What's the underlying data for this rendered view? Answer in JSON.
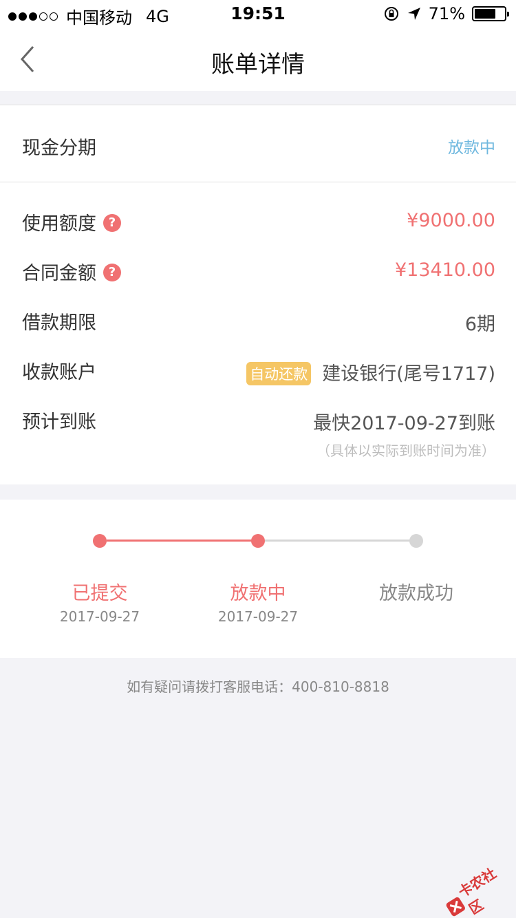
{
  "status_bar": {
    "signal_dots": [
      true,
      true,
      true,
      false,
      false
    ],
    "carrier": "中国移动",
    "network": "4G",
    "time": "19:51",
    "battery_percent": "71%",
    "battery_level": 0.71
  },
  "nav": {
    "title": "账单详情"
  },
  "loan": {
    "type": "现金分期",
    "status": "放款中"
  },
  "details": {
    "used_limit_label": "使用额度",
    "used_limit_value": "¥9000.00",
    "contract_amount_label": "合同金额",
    "contract_amount_value": "¥13410.00",
    "term_label": "借款期限",
    "term_value": "6期",
    "account_label": "收款账户",
    "account_badge": "自动还款",
    "account_value": "建设银行(尾号1717)",
    "eta_label": "预计到账",
    "eta_value": "最快2017-09-27到账",
    "eta_note": "（具体以实际到账时间为准）",
    "help_glyph": "?"
  },
  "progress": {
    "steps": [
      {
        "label": "已提交",
        "date": "2017-09-27"
      },
      {
        "label": "放款中",
        "date": "2017-09-27"
      },
      {
        "label": "放款成功",
        "date": ""
      }
    ]
  },
  "footer": {
    "hotline": "如有疑问请拨打客服电话：400-810-8818"
  },
  "watermark": {
    "text": "卡农社区"
  },
  "colors": {
    "accent_pink": "#f07172",
    "status_blue": "#6fb8df",
    "badge_yellow": "#f5c665",
    "inactive_gray": "#d6d6d6"
  }
}
